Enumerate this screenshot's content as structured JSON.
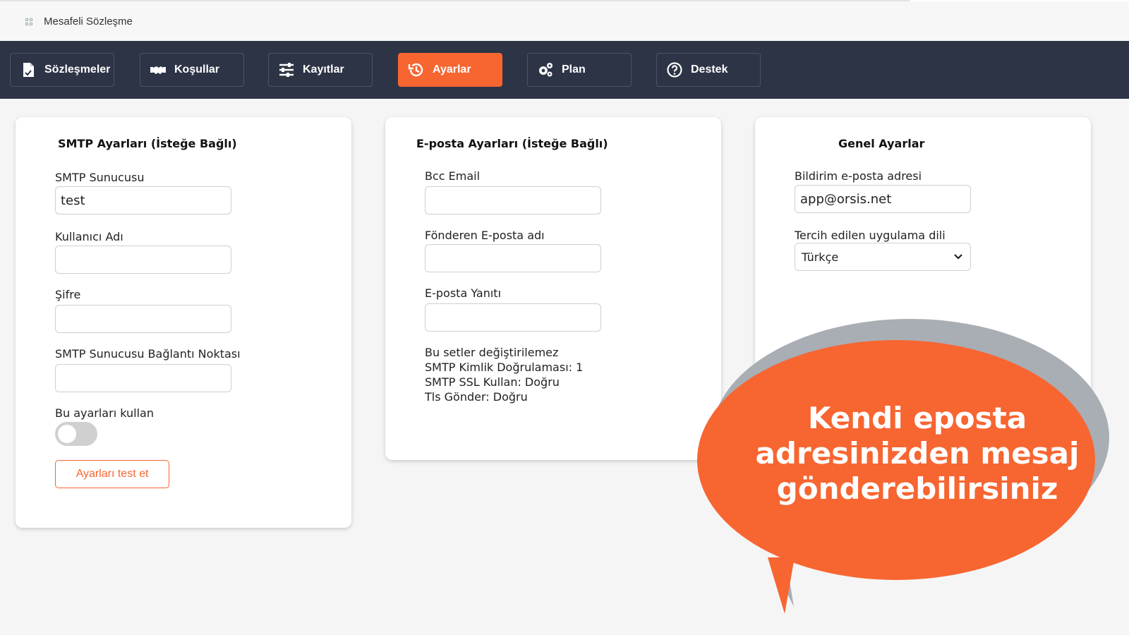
{
  "app": {
    "title": "Mesafeli Sözleşme",
    "icon": "apps-icon"
  },
  "nav": {
    "items": [
      {
        "label": "Sözleşmeler",
        "icon": "document-icon",
        "active": false
      },
      {
        "label": "Koşullar",
        "icon": "handshake-icon",
        "active": false
      },
      {
        "label": "Kayıtlar",
        "icon": "sliders-icon",
        "active": false
      },
      {
        "label": "Ayarlar",
        "icon": "history-icon",
        "active": true
      },
      {
        "label": "Plan",
        "icon": "gears-icon",
        "active": false
      },
      {
        "label": "Destek",
        "icon": "help-circle-icon",
        "active": false
      }
    ]
  },
  "smtp": {
    "title": "SMTP Ayarları (İsteğe Bağlı)",
    "server_label": "SMTP Sunucusu",
    "server_value": "test",
    "username_label": "Kullanıcı Adı",
    "username_value": "",
    "password_label": "Şifre",
    "password_value": "",
    "port_label": "SMTP Sunucusu Bağlantı Noktası",
    "port_value": "",
    "use_label": "Bu ayarları kullan",
    "use_enabled": false,
    "test_button": "Ayarları test et"
  },
  "email": {
    "title": "E-posta Ayarları (İsteğe Bağlı)",
    "bcc_label": "Bcc Email",
    "bcc_value": "",
    "sender_label": "Fönderen E-posta adı",
    "sender_value": "",
    "reply_label": "E-posta Yanıtı",
    "reply_value": "",
    "info_lines": [
      "Bu setler değiştirilemez",
      "SMTP Kimlik Doğrulaması: 1",
      "SMTP SSL Kullan: Doğru",
      "Tls Gönder: Doğru"
    ]
  },
  "general": {
    "title": "Genel Ayarlar",
    "notify_label": "Bildirim e-posta adresi",
    "notify_value": "app@orsis.net",
    "language_label": "Tercih edilen uygulama dili",
    "language_value": "Türkçe"
  },
  "callout": {
    "lines": [
      "Kendi eposta",
      "adresinizden mesaj",
      "gönderebilirsiniz"
    ],
    "bubble_color": "#f76531",
    "shadow_color": "#a9adb4"
  },
  "colors": {
    "accent": "#f76531",
    "navbar": "#2d3446"
  }
}
